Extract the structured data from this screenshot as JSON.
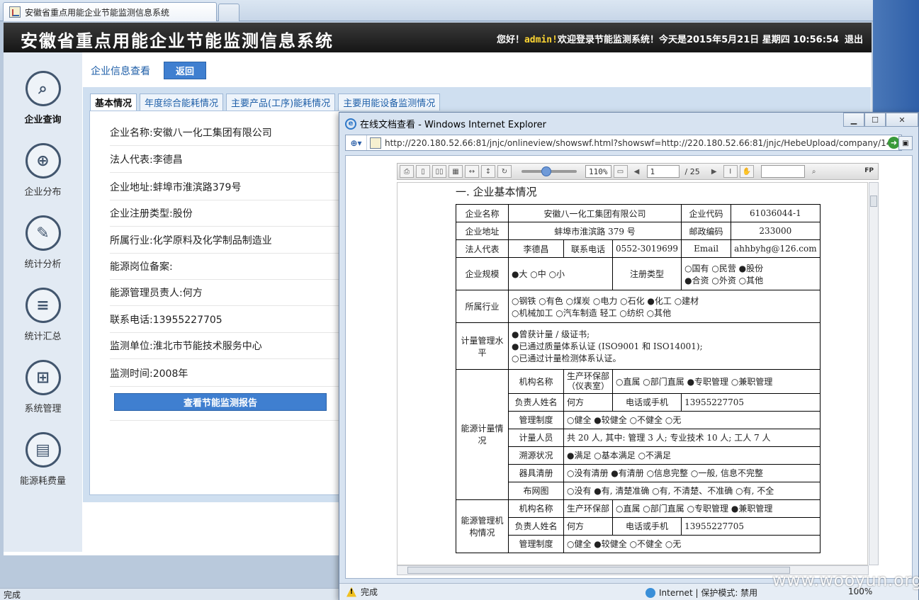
{
  "browser": {
    "tab_title": "安徽省重点用能企业节能监测信息系统"
  },
  "header": {
    "title": "安徽省重点用能企业节能监测信息系统",
    "greeting": "您好！",
    "user": "admin!",
    "welcome_text": "欢迎登录节能监测系统！今天是2015年5月21日 星期四 10:56:54",
    "logout": "退出"
  },
  "sidebar": {
    "items": [
      {
        "label": "企业查询",
        "icon": "search-icon"
      },
      {
        "label": "企业分布",
        "icon": "globe-icon"
      },
      {
        "label": "统计分析",
        "icon": "edit-icon"
      },
      {
        "label": "统计汇总",
        "icon": "list-icon"
      },
      {
        "label": "系统管理",
        "icon": "org-chart-icon"
      },
      {
        "label": "能源耗费量",
        "icon": "battery-icon"
      }
    ]
  },
  "breadcrumb": "企业信息查看",
  "back_button": "返回",
  "tabs": [
    "基本情况",
    "年度综合能耗情况",
    "主要产品(工序)能耗情况",
    "主要用能设备监测情况"
  ],
  "company_info": [
    "企业名称:安徽八一化工集团有限公司",
    "法人代表:李德昌",
    "企业地址:蚌埠市淮滨路379号",
    "企业注册类型:股份",
    "所属行业:化学原料及化学制品制造业",
    "能源岗位备案:",
    "能源管理员责人:何方",
    "联系电话:13955227705",
    "监测单位:淮北市节能技术服务中心",
    "监测时间:2008年"
  ],
  "report_button": "查看节能监测报告",
  "main_status": "完成",
  "popup": {
    "title": "在线文档查看 - Windows Internet Explorer",
    "url": "http://220.180.52.66:81/jnjc/onlineview/showswf.html?showswf=http://220.180.52.66:81/jnjc/HebeUpload/company/14.s",
    "zoom_box": "110%",
    "page_current": "1",
    "page_total": "/ 25",
    "fp_label": "FP",
    "flexpaper": "flexpaper",
    "status": "完成",
    "zone": "Internet | 保护模式: 禁用",
    "zoom": "100%"
  },
  "document": {
    "heading": "一. 企业基本情况",
    "r1": [
      "企业名称",
      "安徽八一化工集团有限公司",
      "企业代码",
      "61036044-1"
    ],
    "r2": [
      "企业地址",
      "蚌埠市淮滨路 379 号",
      "邮政编码",
      "233000"
    ],
    "r3": [
      "法人代表",
      "李德昌",
      "联系电话",
      "0552-3019699",
      "Email",
      "ahhbyhg@126.com"
    ],
    "r4": [
      "企业规模",
      "●大  ○中  ○小",
      "注册类型",
      "○国有  ○民营  ●股份",
      "●合资  ○外资  ○其他"
    ],
    "r5": [
      "所属行业",
      "○钢铁  ○有色  ○煤炭  ○电力  ○石化  ●化工  ○建材",
      "○机械加工  ○汽车制造  轻工  ○纺织  ○其他"
    ],
    "r6": [
      "计量管理水平",
      "●曾获计量 / 级证书;",
      "●已通过质量体系认证 (ISO9001 和 ISO14001);",
      "○已通过计量检测体系认证。"
    ],
    "energy_meter": {
      "label": "能源计量情况",
      "rows": [
        [
          "机构名称",
          "生产环保部（仪表室）",
          "○直属  ○部门直属  ●专职管理  ○兼职管理"
        ],
        [
          "负责人姓名",
          "何方",
          "电话或手机",
          "13955227705"
        ],
        [
          "管理制度",
          "○健全  ●较健全  ○不健全  ○无"
        ],
        [
          "计量人员",
          "共 20 人, 其中: 管理 3 人; 专业技术 10 人; 工人 7 人"
        ],
        [
          "溯源状况",
          "●满足  ○基本满足  ○不满足"
        ],
        [
          "器具清册",
          "○没有清册  ●有清册  ○信息完整  ○一般, 信息不完整"
        ],
        [
          "布网图",
          "○没有  ●有, 清楚准确  ○有, 不清楚、不准确  ○有, 不全"
        ]
      ]
    },
    "energy_mgmt": {
      "label": "能源管理机构情况",
      "rows": [
        [
          "机构名称",
          "生产环保部",
          "○直属  ○部门直属  ○专职管理  ●兼职管理"
        ],
        [
          "负责人姓名",
          "何方",
          "电话或手机",
          "13955227705"
        ],
        [
          "管理制度",
          "○健全  ●较健全  ○不健全  ○无"
        ]
      ]
    }
  },
  "watermark": "www.wooyun.org"
}
